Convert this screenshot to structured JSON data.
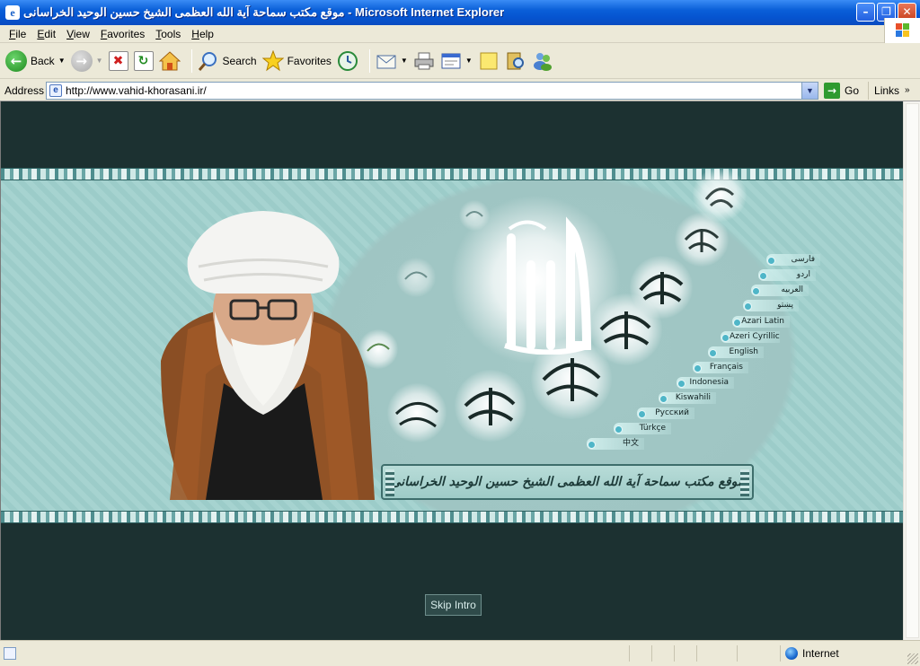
{
  "window": {
    "title": "موقع مكتب سماحة آية الله العظمى الشيخ حسين الوحيد الخراسانى - Microsoft Internet Explorer"
  },
  "menu": [
    {
      "key": "F",
      "rest": "ile"
    },
    {
      "key": "E",
      "rest": "dit"
    },
    {
      "key": "V",
      "rest": "iew"
    },
    {
      "key": "F",
      "rest": "avorites",
      "pre": ""
    },
    {
      "key": "T",
      "rest": "ools"
    },
    {
      "key": "H",
      "rest": "elp"
    }
  ],
  "menu_labels": [
    "File",
    "Edit",
    "View",
    "Favorites",
    "Tools",
    "Help"
  ],
  "toolbar": {
    "back_label": "Back",
    "search_label": "Search",
    "favorites_label": "Favorites"
  },
  "address": {
    "label": "Address",
    "url": "http://www.vahid-khorasani.ir/",
    "go_label": "Go",
    "links_label": "Links"
  },
  "page": {
    "languages": [
      "فارسى",
      "اردو",
      "العربيه",
      "پښتو",
      "Azari Latin",
      "Azeri Cyrillic",
      "English",
      "Français",
      "Indonesia",
      "Kiswahili",
      "Русский",
      "Türkçe",
      "中文"
    ],
    "site_title": "موقع مكتب سماحة آية الله العظمى الشيخ حسين الوحيد الخراسانى",
    "skip_intro": "Skip Intro"
  },
  "status": {
    "zone": "Internet"
  },
  "colors": {
    "page_background": "#1c3131",
    "banner_teal": "#a6d3d0",
    "title_bar_blue": "#0554d0"
  }
}
